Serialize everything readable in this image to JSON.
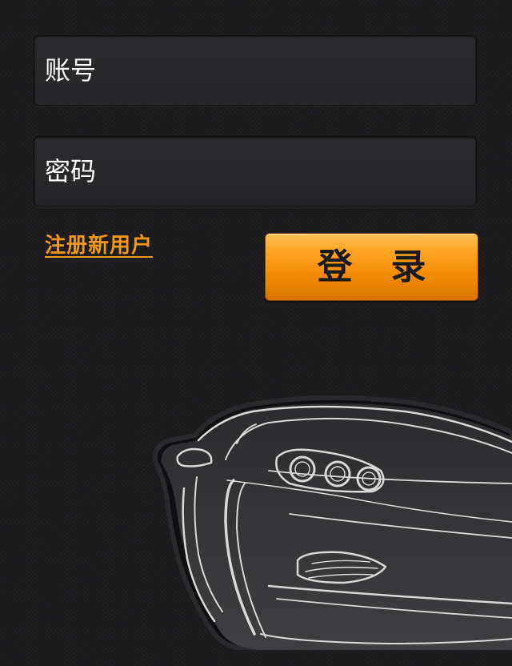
{
  "form": {
    "account_placeholder": "账号",
    "password_placeholder": "密码",
    "register_link_label": "注册新用户",
    "login_button_label": "登录"
  },
  "colors": {
    "background": "#1d1d1f",
    "field_background": "#2a2a2c",
    "accent_orange": "#f0981b",
    "car_outline": "#d8d8d8"
  },
  "icons": {
    "hero_image": "car-illustration"
  }
}
